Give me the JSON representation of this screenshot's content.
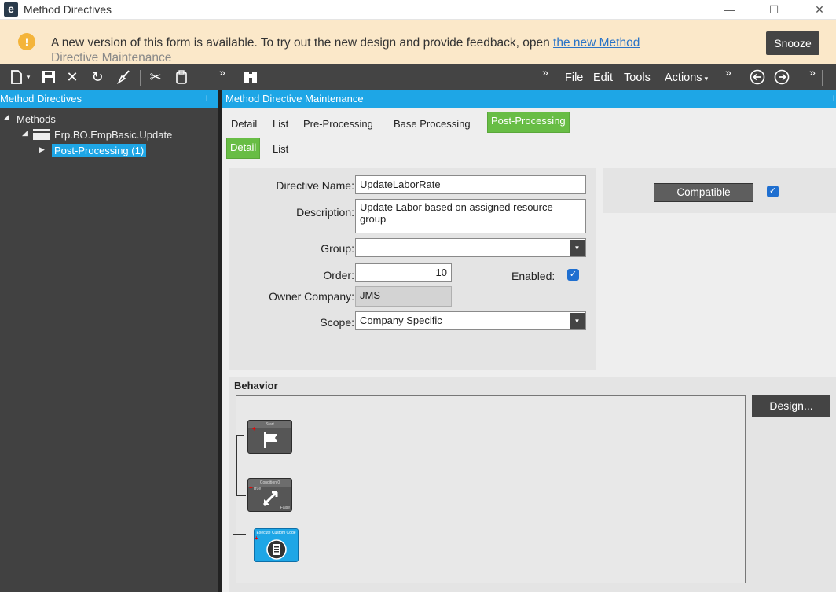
{
  "window": {
    "logo": "e",
    "title": "Method Directives",
    "controls": {
      "minimize": "—",
      "maximize": "☐",
      "close": "✕"
    }
  },
  "banner": {
    "warning_symbol": "!",
    "message": "A new version of this form is available. To try out the new design and provide feedback, open ",
    "link": "the new Method",
    "message_cont": "Directive Maintenance",
    "snooze_label": "Snooze"
  },
  "toolbar": {
    "icons": [
      "new-icon",
      "save-icon",
      "delete-icon",
      "refresh-icon",
      "clear-icon",
      "cut-icon",
      "paste-icon",
      "search-icon"
    ],
    "overflow": "»",
    "menus": {
      "file": "File",
      "edit": "Edit",
      "tools": "Tools",
      "actions": "Actions"
    }
  },
  "left": {
    "header": "Method Directives",
    "pin": "⊥",
    "tree": {
      "root": "Methods",
      "child": "Erp.BO.EmpBasic.Update",
      "leaf": "Post-Processing (1)"
    }
  },
  "main": {
    "header": "Method Directive Maintenance",
    "tabs": [
      "Detail",
      "List",
      "Pre-Processing",
      "Base Processing",
      "Post-Processing"
    ],
    "active_tab": "Post-Processing",
    "subtabs": [
      "Detail",
      "List"
    ],
    "active_subtab": "Detail",
    "form": {
      "directive_name_label": "Directive Name:",
      "directive_name": "UpdateLaborRate",
      "description_label": "Description:",
      "description": "Update Labor based on assigned resource group",
      "group_label": "Group:",
      "group": "",
      "order_label": "Order:",
      "order": "10",
      "enabled_label": "Enabled:",
      "enabled": true,
      "owner_company_label": "Owner Company:",
      "owner_company": "JMS",
      "scope_label": "Scope:",
      "scope": "Company Specific"
    },
    "compatible_label": "Compatible",
    "compatible": true,
    "behavior_label": "Behavior",
    "design_button": "Design...",
    "workflow": {
      "start": "Start",
      "condition": "Condition 0",
      "condition_true": "True",
      "condition_false": "False",
      "execute": "Execute Custom Code"
    }
  }
}
